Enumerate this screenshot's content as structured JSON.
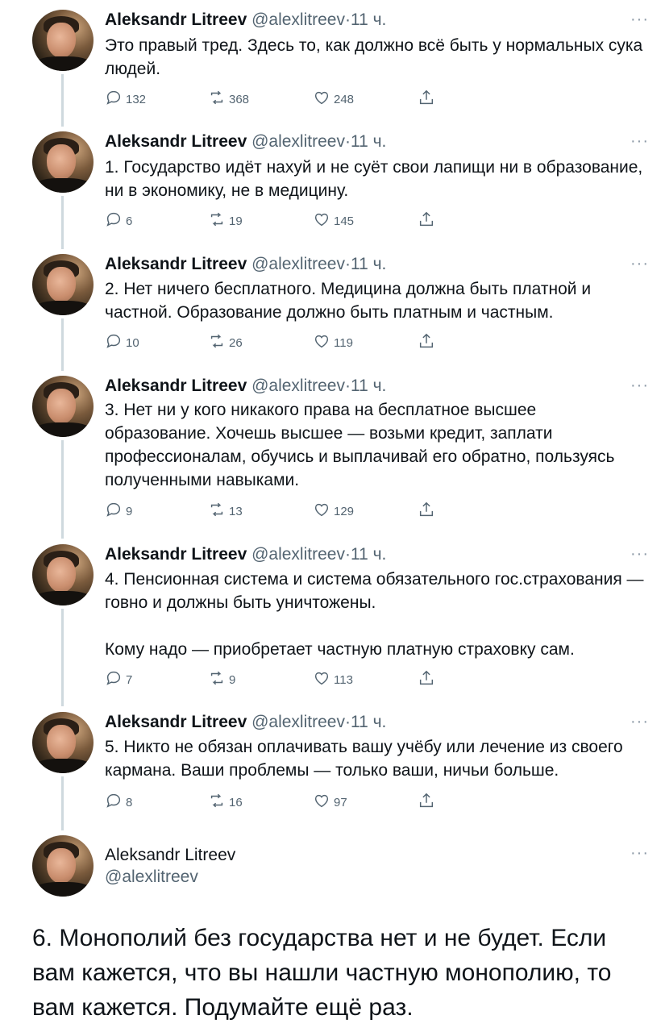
{
  "tweets": [
    {
      "name": "Aleksandr Litreev",
      "handle": "@alexlitreev",
      "dot": "·",
      "time": "11 ч.",
      "more": "···",
      "lines": [
        "Это правый тред. Здесь то, как должно всё быть у нормальных сука людей."
      ],
      "replies": "132",
      "retweets": "368",
      "likes": "248"
    },
    {
      "name": "Aleksandr Litreev",
      "handle": "@alexlitreev",
      "dot": "·",
      "time": "11 ч.",
      "more": "···",
      "lines": [
        "1. Государство идёт нахуй и не суёт свои лапищи ни в образование, ни в экономику, не в медицину."
      ],
      "replies": "6",
      "retweets": "19",
      "likes": "145"
    },
    {
      "name": "Aleksandr Litreev",
      "handle": "@alexlitreev",
      "dot": "·",
      "time": "11 ч.",
      "more": "···",
      "lines": [
        "2. Нет ничего бесплатного. Медицина должна быть платной и частной. Образование должно быть платным и частным."
      ],
      "replies": "10",
      "retweets": "26",
      "likes": "119"
    },
    {
      "name": "Aleksandr Litreev",
      "handle": "@alexlitreev",
      "dot": "·",
      "time": "11 ч.",
      "more": "···",
      "lines": [
        "3. Нет ни у кого никакого права на бесплатное высшее образование. Хочешь высшее — возьми кредит, заплати профессионалам, обучись и выплачивай его обратно, пользуясь полученными навыками."
      ],
      "replies": "9",
      "retweets": "13",
      "likes": "129"
    },
    {
      "name": "Aleksandr Litreev",
      "handle": "@alexlitreev",
      "dot": "·",
      "time": "11 ч.",
      "more": "···",
      "lines": [
        "4. Пенсионная система и система обязательного гос.страхования — говно и должны быть уничтожены.",
        "Кому надо — приобретает частную платную страховку сам."
      ],
      "replies": "7",
      "retweets": "9",
      "likes": "113"
    },
    {
      "name": "Aleksandr Litreev",
      "handle": "@alexlitreev",
      "dot": "·",
      "time": "11 ч.",
      "more": "···",
      "lines": [
        "5. Никто не обязан оплачивать вашу учёбу или лечение из своего кармана. Ваши проблемы — только ваши, ничьи больше."
      ],
      "replies": "8",
      "retweets": "16",
      "likes": "97"
    }
  ],
  "last_tweet": {
    "name": "Aleksandr Litreev",
    "handle": "@alexlitreev",
    "more": "···",
    "text": "6. Монополий без государства нет и не будет. Если вам кажется, что вы нашли частную монополию, то вам кажется. Подумайте ещё раз."
  },
  "colors": {
    "text": "#0f1419",
    "secondary": "#536471",
    "rail": "#cfd9de"
  },
  "icons": [
    "reply-icon",
    "retweet-icon",
    "like-icon",
    "share-icon",
    "more-icon"
  ]
}
